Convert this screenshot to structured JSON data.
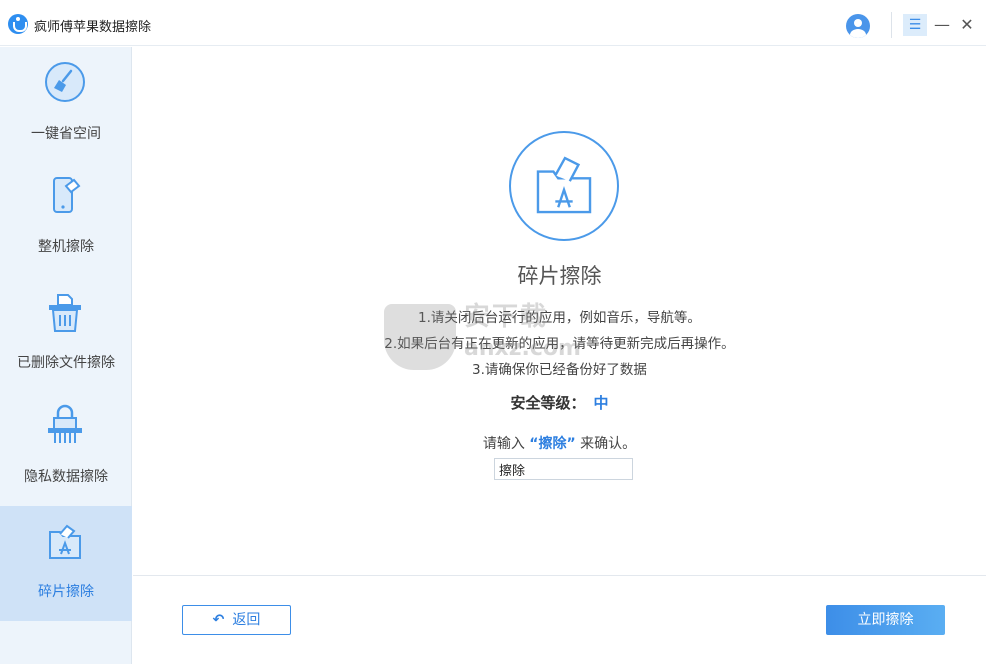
{
  "window": {
    "title": "疯师傅苹果数据擦除",
    "menu_glyph": "☰",
    "minimize_glyph": "—",
    "close_glyph": "✕"
  },
  "sidebar": {
    "items": [
      {
        "label": "一键省空间",
        "icon": "broom-icon",
        "active": false
      },
      {
        "label": "整机擦除",
        "icon": "phone-eraser-icon",
        "active": false
      },
      {
        "label": "已删除文件擦除",
        "icon": "trash-file-icon",
        "active": false
      },
      {
        "label": "隐私数据擦除",
        "icon": "lock-shredder-icon",
        "active": false
      },
      {
        "label": "碎片擦除",
        "icon": "app-folder-icon",
        "active": true
      }
    ]
  },
  "main": {
    "hero_icon": "app-folder-icon",
    "title": "碎片擦除",
    "instructions": [
      "1.请关闭后台运行的应用，例如音乐，导航等。",
      "2.如果后台有正在更新的应用，请等待更新完成后再操作。",
      "3.请确保你已经备份好了数据"
    ],
    "security_label": "安全等级：",
    "security_level": "中",
    "confirm_prefix": "请输入",
    "confirm_keyword": "“擦除”",
    "confirm_suffix": "来确认。",
    "confirm_value": "擦除",
    "back_label": "返回",
    "back_icon": "back-arrow-icon",
    "erase_label": "立即擦除"
  },
  "watermark": {
    "text": "安下载",
    "sub": "anxz.com"
  },
  "colors": {
    "accent": "#2d7fe0",
    "sidebar_bg": "#edf4fb",
    "sidebar_active": "#cfe2f7"
  }
}
